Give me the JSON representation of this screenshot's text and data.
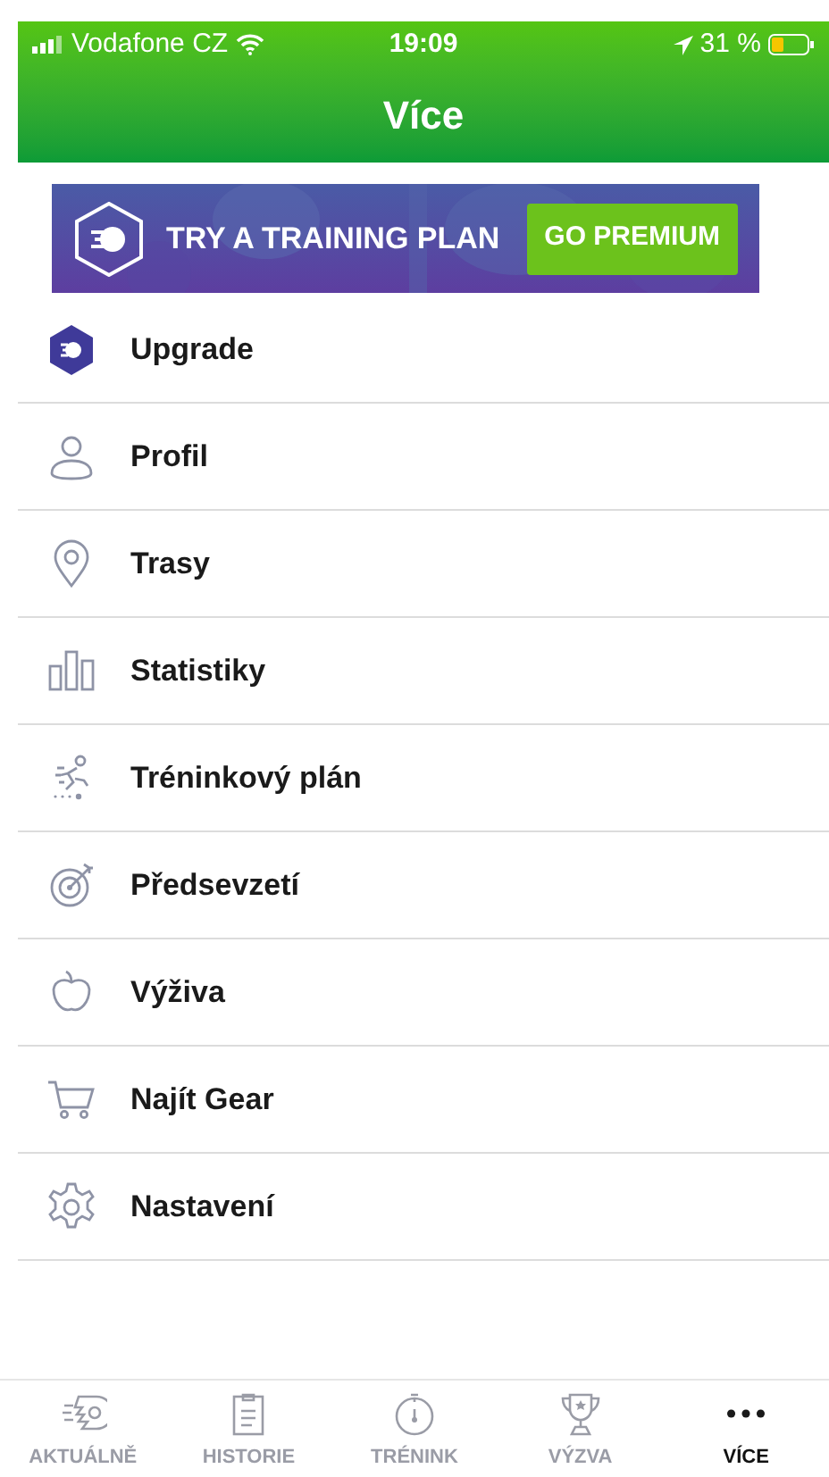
{
  "status_bar": {
    "carrier": "Vodafone CZ",
    "time": "19:09",
    "battery": "31 %"
  },
  "header": {
    "title": "Více"
  },
  "banner": {
    "text": "TRY A TRAINING PLAN",
    "button": "GO PREMIUM"
  },
  "menu": [
    {
      "kind": "upgrade",
      "label": "Upgrade"
    },
    {
      "kind": "profile",
      "label": "Profil"
    },
    {
      "kind": "routes",
      "label": "Trasy"
    },
    {
      "kind": "stats",
      "label": "Statistiky"
    },
    {
      "kind": "plan",
      "label": "Tréninkový plán"
    },
    {
      "kind": "goals",
      "label": "Předsevzetí"
    },
    {
      "kind": "nutrition",
      "label": "Výživa"
    },
    {
      "kind": "gear",
      "label": "Najít Gear"
    },
    {
      "kind": "settings",
      "label": "Nastavení"
    }
  ],
  "tab_bar": [
    {
      "kind": "feed",
      "label": "AKTUÁLNĚ",
      "selected": false
    },
    {
      "kind": "history",
      "label": "HISTORIE",
      "selected": false
    },
    {
      "kind": "training",
      "label": "TRÉNINK",
      "selected": false
    },
    {
      "kind": "challenge",
      "label": "VÝZVA",
      "selected": false
    },
    {
      "kind": "more",
      "label": "VÍCE",
      "selected": true
    }
  ]
}
